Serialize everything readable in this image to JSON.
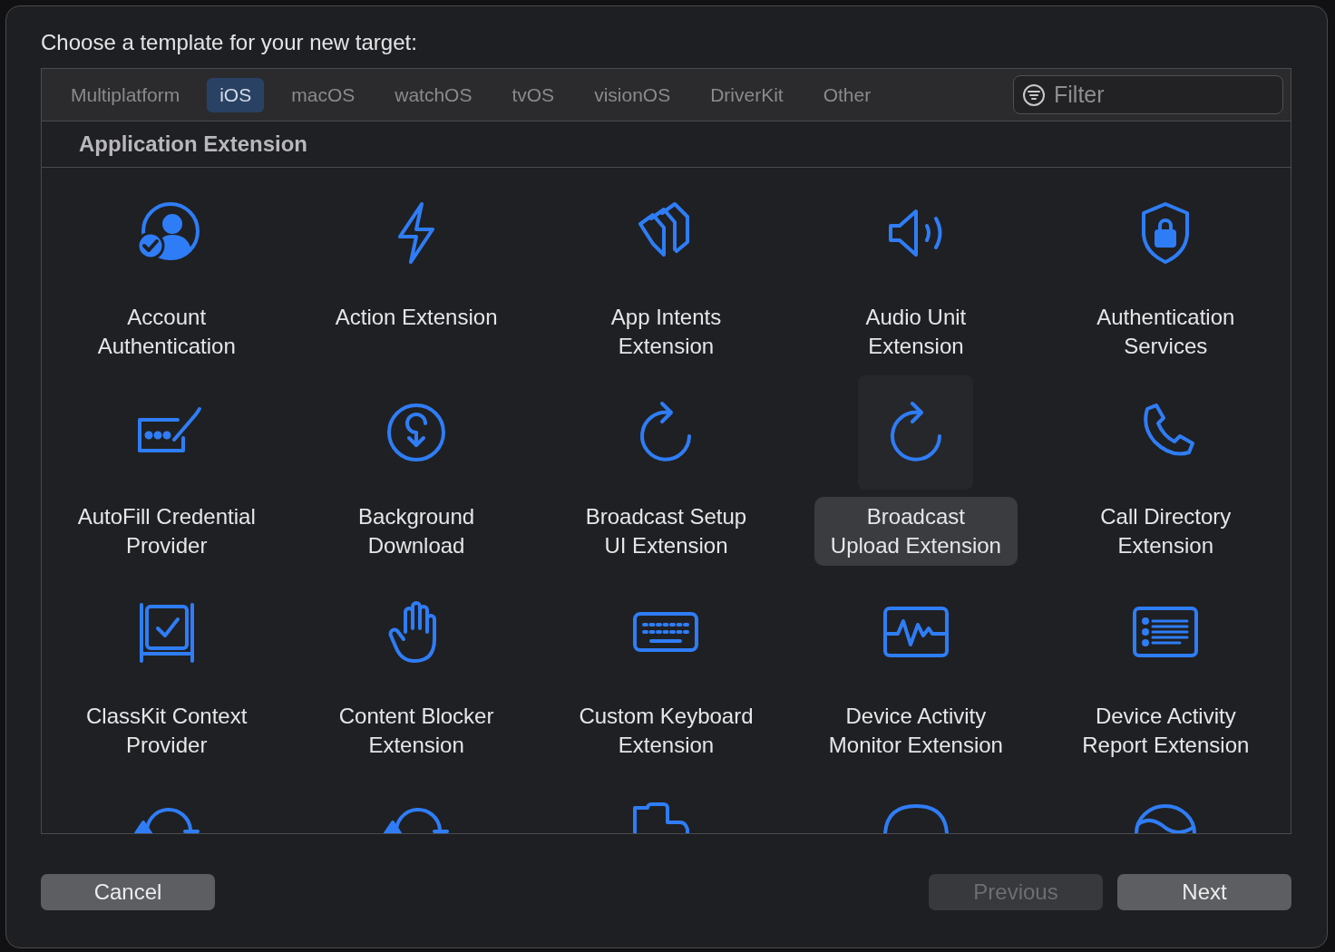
{
  "title": "Choose a template for your new target:",
  "tabs": [
    {
      "label": "Multiplatform",
      "selected": false
    },
    {
      "label": "iOS",
      "selected": true
    },
    {
      "label": "macOS",
      "selected": false
    },
    {
      "label": "watchOS",
      "selected": false
    },
    {
      "label": "tvOS",
      "selected": false
    },
    {
      "label": "visionOS",
      "selected": false
    },
    {
      "label": "DriverKit",
      "selected": false
    },
    {
      "label": "Other",
      "selected": false
    }
  ],
  "filter": {
    "placeholder": "Filter"
  },
  "section": "Application Extension",
  "templates": [
    {
      "kind": "account",
      "label": "Account\nAuthentication",
      "selected": false
    },
    {
      "kind": "bolt",
      "label": "Action Extension",
      "selected": false
    },
    {
      "kind": "pages",
      "label": "App Intents\nExtension",
      "selected": false
    },
    {
      "kind": "speaker",
      "label": "Audio Unit\nExtension",
      "selected": false
    },
    {
      "kind": "shield",
      "label": "Authentication\nServices",
      "selected": false
    },
    {
      "kind": "password",
      "label": "AutoFill Credential\nProvider",
      "selected": false
    },
    {
      "kind": "download",
      "label": "Background\nDownload",
      "selected": false
    },
    {
      "kind": "refresh",
      "label": "Broadcast Setup\nUI Extension",
      "selected": false
    },
    {
      "kind": "refresh",
      "label": "Broadcast\nUpload Extension",
      "selected": true
    },
    {
      "kind": "phone",
      "label": "Call Directory\nExtension",
      "selected": false
    },
    {
      "kind": "board",
      "label": "ClassKit Context\nProvider",
      "selected": false
    },
    {
      "kind": "hand",
      "label": "Content Blocker\nExtension",
      "selected": false
    },
    {
      "kind": "keyboard",
      "label": "Custom Keyboard\nExtension",
      "selected": false
    },
    {
      "kind": "monitor",
      "label": "Device Activity\nMonitor Extension",
      "selected": false
    },
    {
      "kind": "list",
      "label": "Device Activity\nReport Extension",
      "selected": false
    },
    {
      "kind": "sync"
    },
    {
      "kind": "sync"
    },
    {
      "kind": "puzzle"
    },
    {
      "kind": "bubble"
    },
    {
      "kind": "gauge"
    }
  ],
  "buttons": [
    {
      "label": "Cancel",
      "disabled": false
    },
    {
      "label": "Previous",
      "disabled": true
    },
    {
      "label": "Next",
      "disabled": false
    }
  ]
}
